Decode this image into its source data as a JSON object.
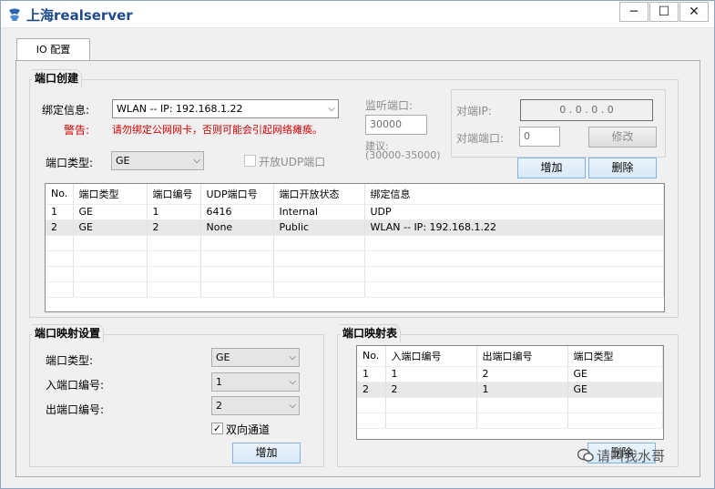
{
  "app": {
    "title": "上海realserver",
    "minimize_glyph": "─",
    "maximize_glyph": "☐",
    "close_glyph": "✕"
  },
  "tabs": [
    {
      "label": "IO 配置"
    }
  ],
  "port_create": {
    "title": "端口创建",
    "bind_label": "绑定信息:",
    "bind_value": "WLAN -- IP: 192.168.1.22",
    "warning_label": "警告:",
    "warning_text": "请勿绑定公网网卡，否则可能会引起网络瘫痪。",
    "port_type_label": "端口类型:",
    "port_type_value": "GE",
    "open_udp_label": "开放UDP端口",
    "listen_port_label": "监听端口:",
    "listen_port_value": "30000",
    "suggest_label": "建议:",
    "suggest_range": "(30000-35000)",
    "peer_ip_label": "对端IP:",
    "peer_ip_value": "0 . 0 . 0 . 0",
    "peer_port_label": "对端端口:",
    "peer_port_value": "0",
    "modify_button": "修改",
    "add_button": "增加",
    "delete_button": "删除",
    "table": {
      "headers": [
        "No.",
        "端口类型",
        "端口编号",
        "UDP端口号",
        "端口开放状态",
        "绑定信息"
      ],
      "rows": [
        [
          "1",
          "GE",
          "1",
          "6416",
          "Internal",
          "UDP"
        ],
        [
          "2",
          "GE",
          "2",
          "None",
          "Public",
          "WLAN -- IP: 192.168.1.22"
        ],
        [
          "",
          "",
          "",
          "",
          "",
          ""
        ],
        [
          "",
          "",
          "",
          "",
          "",
          ""
        ],
        [
          "",
          "",
          "",
          "",
          "",
          ""
        ],
        [
          "",
          "",
          "",
          "",
          "",
          ""
        ]
      ]
    }
  },
  "port_mapping_settings": {
    "title": "端口映射设置",
    "port_type_label": "端口类型:",
    "port_type_value": "GE",
    "in_port_label": "入端口编号:",
    "in_port_value": "1",
    "out_port_label": "出端口编号:",
    "out_port_value": "2",
    "bidirectional_label": "双向通道",
    "bidirectional_checked": true,
    "add_button": "增加"
  },
  "port_mapping_table": {
    "title": "端口映射表",
    "delete_button": "删除",
    "table": {
      "headers": [
        "No.",
        "入端口编号",
        "出端口编号",
        "端口类型"
      ],
      "rows": [
        [
          "1",
          "1",
          "2",
          "GE"
        ],
        [
          "2",
          "2",
          "1",
          "GE"
        ],
        [
          "",
          "",
          "",
          ""
        ],
        [
          "",
          "",
          "",
          ""
        ]
      ]
    }
  },
  "watermark": {
    "text": "请叫我水哥"
  },
  "colors": {
    "title": "#1f4a8a",
    "warning": "#d40000",
    "accent_border": "#7eb4ea"
  }
}
